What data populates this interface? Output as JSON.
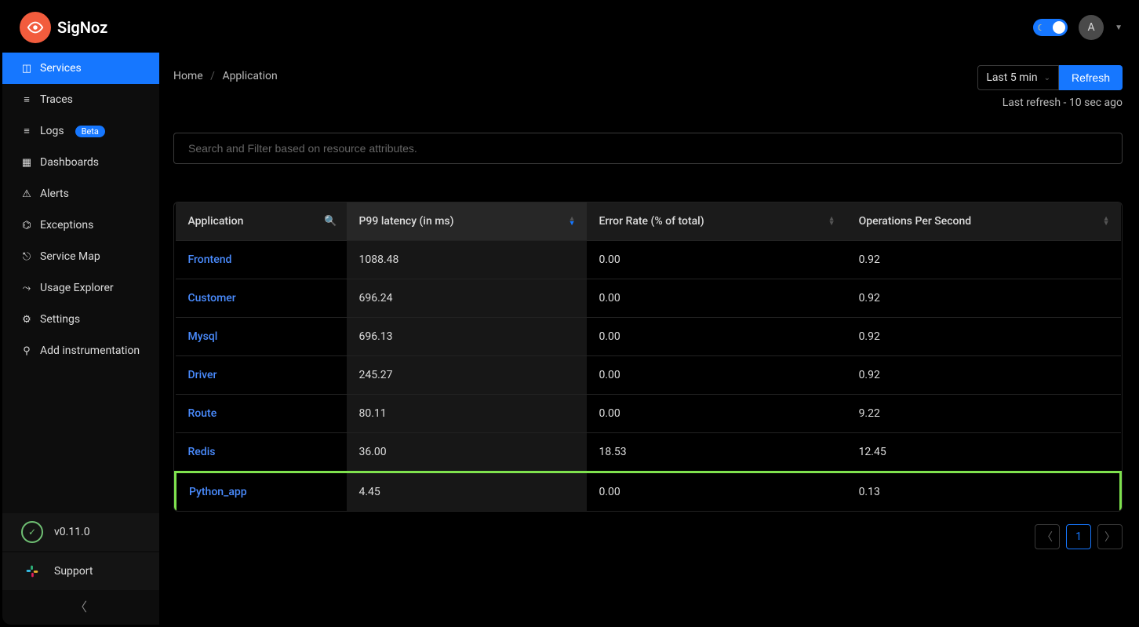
{
  "header": {
    "brand": "SigNoz",
    "avatar_initial": "A"
  },
  "sidebar": {
    "items": [
      {
        "label": "Services",
        "icon": "bar-chart-icon",
        "active": true
      },
      {
        "label": "Traces",
        "icon": "menu-icon"
      },
      {
        "label": "Logs",
        "icon": "menu-icon",
        "badge": "Beta"
      },
      {
        "label": "Dashboards",
        "icon": "dashboard-icon"
      },
      {
        "label": "Alerts",
        "icon": "alert-icon"
      },
      {
        "label": "Exceptions",
        "icon": "bug-icon"
      },
      {
        "label": "Service Map",
        "icon": "deployment-icon"
      },
      {
        "label": "Usage Explorer",
        "icon": "line-chart-icon"
      },
      {
        "label": "Settings",
        "icon": "gear-icon"
      },
      {
        "label": "Add instrumentation",
        "icon": "api-icon"
      }
    ],
    "version": "v0.11.0",
    "support": "Support"
  },
  "breadcrumb": {
    "home": "Home",
    "current": "Application"
  },
  "controls": {
    "time_range": "Last 5 min",
    "refresh_label": "Refresh",
    "last_refresh": "Last refresh - 10 sec ago"
  },
  "search": {
    "placeholder": "Search and Filter based on resource attributes."
  },
  "table": {
    "columns": {
      "application": "Application",
      "p99": "P99 latency (in ms)",
      "error_rate": "Error Rate (% of total)",
      "ops": "Operations Per Second"
    },
    "rows": [
      {
        "app": "Frontend",
        "p99": "1088.48",
        "error": "0.00",
        "ops": "0.92"
      },
      {
        "app": "Customer",
        "p99": "696.24",
        "error": "0.00",
        "ops": "0.92"
      },
      {
        "app": "Mysql",
        "p99": "696.13",
        "error": "0.00",
        "ops": "0.92"
      },
      {
        "app": "Driver",
        "p99": "245.27",
        "error": "0.00",
        "ops": "0.92"
      },
      {
        "app": "Route",
        "p99": "80.11",
        "error": "0.00",
        "ops": "9.22"
      },
      {
        "app": "Redis",
        "p99": "36.00",
        "error": "18.53",
        "ops": "12.45"
      },
      {
        "app": "Python_app",
        "p99": "4.45",
        "error": "0.00",
        "ops": "0.13",
        "highlight": true
      }
    ]
  },
  "pagination": {
    "current": "1"
  }
}
